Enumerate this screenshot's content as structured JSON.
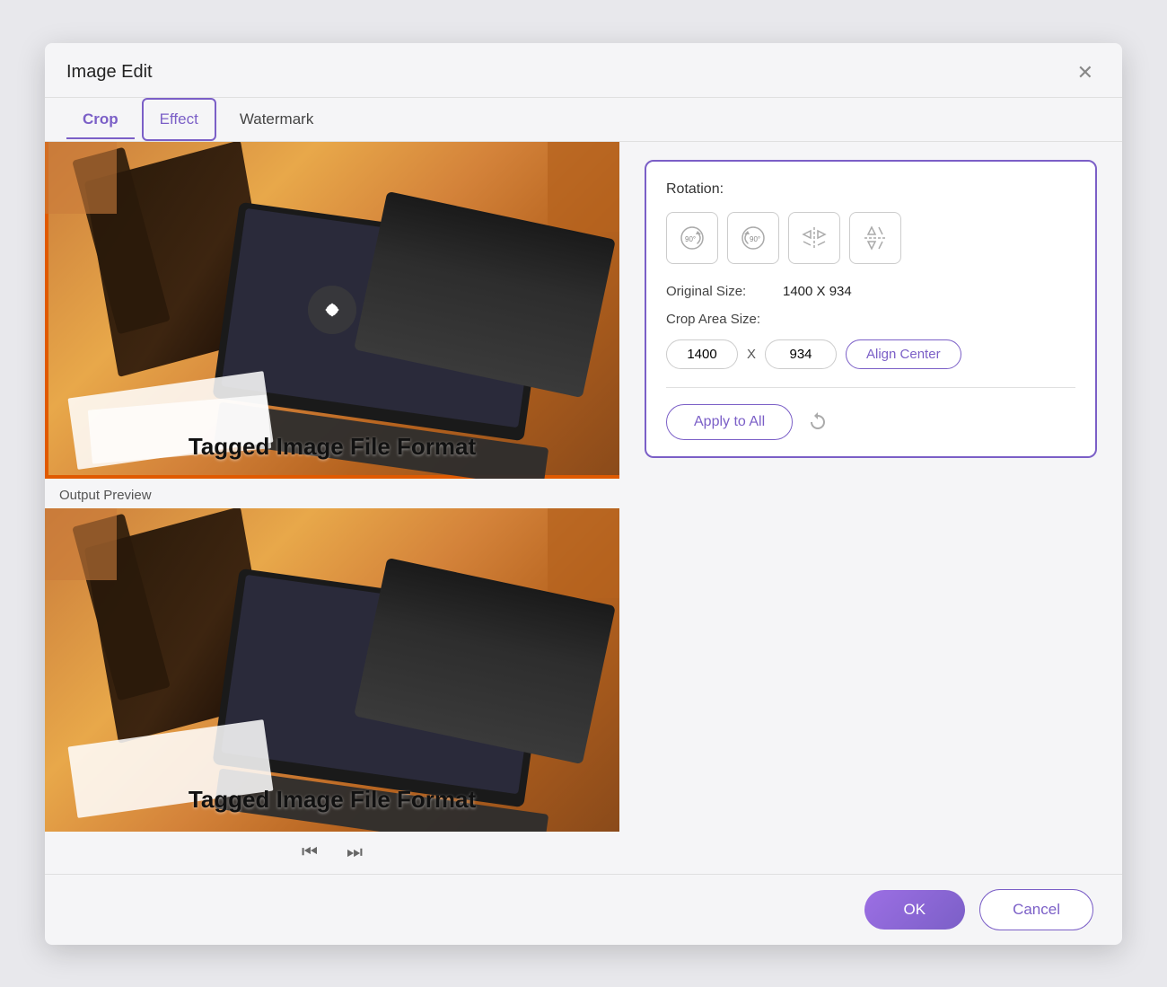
{
  "dialog": {
    "title": "Image Edit",
    "close_icon": "✕"
  },
  "tabs": [
    {
      "id": "crop",
      "label": "Crop",
      "active": true,
      "boxed": false
    },
    {
      "id": "effect",
      "label": "Effect",
      "active": false,
      "boxed": true
    },
    {
      "id": "watermark",
      "label": "Watermark",
      "active": false,
      "boxed": false
    }
  ],
  "image": {
    "label": "Tagged Image File Format"
  },
  "output_preview_label": "Output Preview",
  "rotation": {
    "title": "Rotation:",
    "buttons": [
      {
        "id": "rot-cw",
        "icon": "↻90°",
        "label": "Rotate 90° Clockwise"
      },
      {
        "id": "rot-ccw",
        "icon": "↺90°",
        "label": "Rotate 90° Counter-Clockwise"
      },
      {
        "id": "flip-h",
        "icon": "⇔",
        "label": "Flip Horizontal"
      },
      {
        "id": "flip-v",
        "icon": "⇕",
        "label": "Flip Vertical"
      }
    ]
  },
  "original_size": {
    "label": "Original Size:",
    "value": "1400 X 934"
  },
  "crop_area": {
    "label": "Crop Area Size:",
    "width": "1400",
    "height": "934",
    "x_label": "X",
    "align_label": "Align Center"
  },
  "apply_all": {
    "label": "Apply to All"
  },
  "footer": {
    "ok_label": "OK",
    "cancel_label": "Cancel"
  },
  "nav": {
    "prev_icon": "⏮",
    "next_icon": "⏭"
  }
}
